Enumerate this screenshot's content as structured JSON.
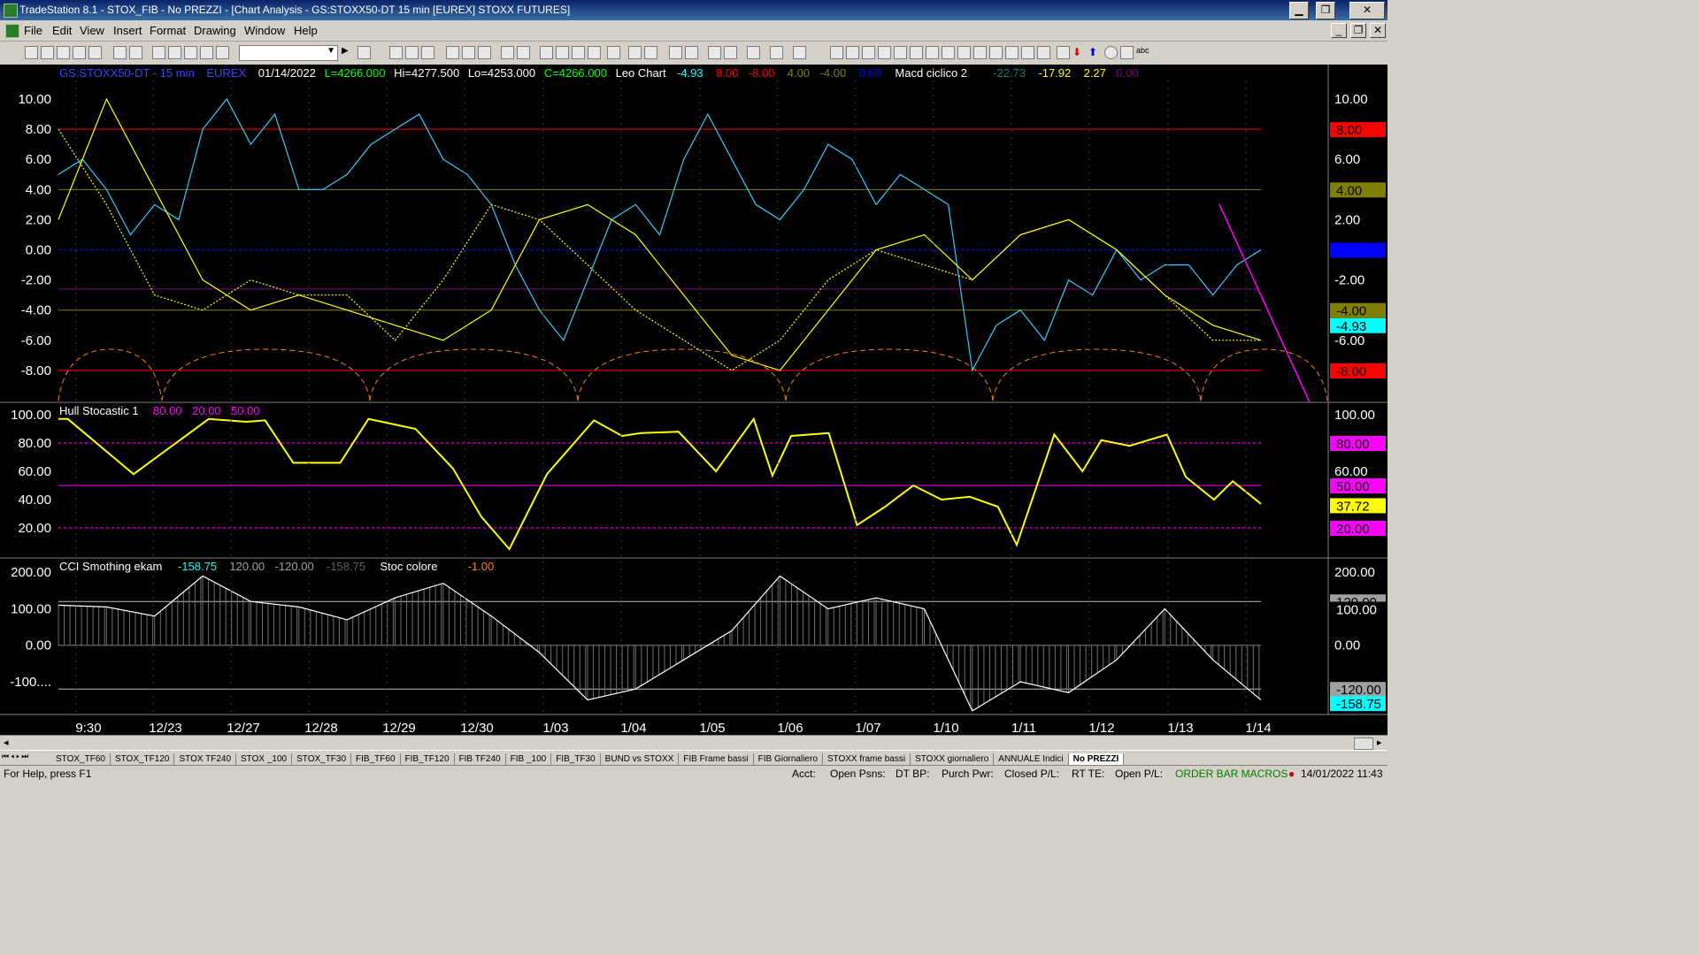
{
  "window": {
    "title": "TradeStation 8.1 - STOX_FIB - No PREZZI - [Chart Analysis - GS:STOXX50-DT  15 min  [EUREX] STOXX FUTURES]",
    "min": "▁",
    "max": "❐",
    "close": "✕",
    "child_min": "_",
    "child_restore": "❐",
    "child_close": "✕"
  },
  "menu": [
    "File",
    "Edit",
    "View",
    "Insert",
    "Format",
    "Drawing",
    "Window",
    "Help"
  ],
  "panel1": {
    "symbol": "GS:STOXX50-DT - 15 min",
    "exchange": "EUREX",
    "date": "01/14/2022",
    "last": "L=4266.000",
    "hi": "Hi=4277.500",
    "lo": "Lo=4253.000",
    "close": "C=4266.000",
    "ind1_name": "Leo Chart",
    "ind1_vals": [
      "-4.93",
      "8.00",
      "-8.00",
      "4.00",
      "-4.00",
      "0.00"
    ],
    "ind1_colors": [
      "#00ffff",
      "#ff0000",
      "#ff0000",
      "#808000",
      "#808000",
      "#0000ff"
    ],
    "ind2_name": "Macd ciclico 2",
    "ind2_vals": [
      "-22.73",
      "-17.92",
      "2.27",
      "0.00"
    ],
    "ind2_colors": [
      "#008080",
      "#ffff00",
      "#ffff00",
      "#800080"
    ],
    "ticks": [
      "10.00",
      "8.00",
      "6.00",
      "4.00",
      "2.00",
      "0.00",
      "-2.00",
      "-4.00",
      "-6.00",
      "-8.00"
    ],
    "tick_values": [
      10,
      8,
      6,
      4,
      2,
      0,
      -2,
      -4,
      -6,
      -8
    ],
    "right_ticks": [
      "10.00",
      "6.00",
      "2.00",
      "-2.00",
      "-6.00"
    ],
    "right_tick_values": [
      10,
      6,
      2,
      -2,
      -6
    ],
    "badges": [
      {
        "label": "8.00",
        "value": 8,
        "bg": "#ff0000",
        "fg": "#000000"
      },
      {
        "label": "4.00",
        "value": 4,
        "bg": "#808000",
        "fg": "#000000"
      },
      {
        "label": "0.00",
        "value": 0,
        "bg": "#0000ff",
        "fg": "#0000ff"
      },
      {
        "label": "-4.00",
        "value": -4,
        "bg": "#808000",
        "fg": "#000000"
      },
      {
        "label": "-4.93",
        "value": -5,
        "bg": "#00ffff",
        "fg": "#000000"
      },
      {
        "label": "-8.00",
        "value": -8,
        "bg": "#ff0000",
        "fg": "#000000"
      }
    ]
  },
  "panel2": {
    "name": "Hull Stocastic 1",
    "vals": [
      "80.00",
      "20.00",
      "50.00"
    ],
    "val_colors": [
      "#ff00ff",
      "#ff00ff",
      "#ff00ff"
    ],
    "ticks": [
      "100.00",
      "80.00",
      "60.00",
      "40.00",
      "20.00"
    ],
    "tick_values": [
      100,
      80,
      60,
      40,
      20
    ],
    "right_ticks": [
      "100.00",
      "60.00"
    ],
    "right_tick_values": [
      100,
      60
    ],
    "badges": [
      {
        "label": "80.00",
        "value": 80,
        "bg": "#ff00ff",
        "fg": "#000000"
      },
      {
        "label": "50.00",
        "value": 50,
        "bg": "#ff00ff",
        "fg": "#000000"
      },
      {
        "label": "37.72",
        "value": 36,
        "bg": "#ffff00",
        "fg": "#000000"
      },
      {
        "label": "20.00",
        "value": 20,
        "bg": "#ff00ff",
        "fg": "#000000"
      }
    ]
  },
  "panel3": {
    "name": "CCI Smothing ekam",
    "vals": [
      "-158.75",
      "120.00",
      "-120.00",
      "-158.75"
    ],
    "val_colors": [
      "#00ffff",
      "#a0a0a0",
      "#a0a0a0",
      "#606060"
    ],
    "ind2_name": "Stoc colore",
    "ind2_vals": [
      "-1.00"
    ],
    "ind2_colors": [
      "#ff8000"
    ],
    "ticks": [
      "200.00",
      "100.00",
      "0.00",
      "-100...."
    ],
    "tick_values": [
      200,
      100,
      0,
      -100
    ],
    "right_ticks": [
      "200.00",
      "0.00"
    ],
    "right_tick_values": [
      200,
      0
    ],
    "badges": [
      {
        "label": "120.00",
        "value": 120,
        "bg": "#a0a0a0",
        "fg": "#000000"
      },
      {
        "label": "100.00",
        "value": 100,
        "bg": "#000000",
        "fg": "#ffffff"
      },
      {
        "label": "-120.00",
        "value": -120,
        "bg": "#a0a0a0",
        "fg": "#000000"
      },
      {
        "label": "-158.75",
        "value": -158.75,
        "bg": "#00ffff",
        "fg": "#000000"
      }
    ]
  },
  "xaxis": [
    "9:30",
    "12/23",
    "12/27",
    "12/28",
    "12/29",
    "12/30",
    "1/03",
    "1/04",
    "1/05",
    "1/06",
    "1/07",
    "1/10",
    "1/11",
    "1/12",
    "1/13",
    "1/14"
  ],
  "tabs": [
    "STOX_TF60",
    "STOX_TF120",
    "STOX TF240",
    "STOX _100",
    "STOX_TF30",
    "FIB_TF60",
    "FIB_TF120",
    "FIB TF240",
    "FIB _100",
    "FIB_TF30",
    "BUND vs STOXX",
    "FIB Frame bassi",
    "FIB Giornaliero",
    "STOXX frame bassi",
    "STOXX giornaliero",
    "ANNUALE Indici",
    "No PREZZI"
  ],
  "active_tab": "No PREZZI",
  "status": {
    "help": "For Help, press F1",
    "acct": "Acct:",
    "open_psns": "Open Psns:",
    "dt_bp": "DT BP:",
    "purch_pwr": "Purch Pwr:",
    "closed_pl": "Closed P/L:",
    "rt_te": "RT TE:",
    "open_pl": "Open P/L:",
    "macros": "ORDER BAR  MACROS",
    "datetime": "14/01/2022 11:43"
  },
  "chart_data": [
    {
      "type": "line",
      "title": "Leo Chart / Macd ciclico 2",
      "ylim": [
        -10,
        11
      ],
      "hlines": [
        8,
        4,
        0,
        -2.6,
        -4,
        -8
      ],
      "series": [
        {
          "name": "Leo Chart",
          "color": "#33ccff",
          "x": [
            0,
            10,
            20,
            30,
            40,
            50,
            60,
            70,
            80,
            90,
            100,
            110,
            120,
            130,
            140,
            150,
            160,
            170,
            180,
            190,
            200,
            210,
            220,
            230,
            240,
            250,
            260,
            270,
            280,
            290,
            300,
            310,
            320,
            330,
            340,
            350,
            360,
            370,
            380,
            390,
            400,
            410,
            420,
            430,
            440,
            450,
            460,
            470,
            480,
            490,
            500
          ],
          "values": [
            5,
            6,
            4,
            1,
            3,
            2,
            8,
            10,
            7,
            9,
            4,
            4,
            5,
            7,
            8,
            9,
            6,
            5,
            3,
            -1,
            -4,
            -6,
            -2,
            2,
            3,
            1,
            6,
            9,
            6,
            3,
            2,
            4,
            7,
            6,
            3,
            5,
            4,
            3,
            -8,
            -5,
            -4,
            -6,
            -2,
            -3,
            0,
            -2,
            -1,
            -1,
            -3,
            -1,
            0
          ]
        },
        {
          "name": "Leo Chart 2",
          "color": "#ffff00",
          "x": [
            0,
            20,
            40,
            60,
            80,
            100,
            120,
            140,
            160,
            180,
            200,
            220,
            240,
            260,
            280,
            300,
            320,
            340,
            360,
            380,
            400,
            420,
            440,
            460,
            480,
            500
          ],
          "values": [
            2,
            10,
            4,
            -2,
            -4,
            -3,
            -4,
            -5,
            -6,
            -4,
            2,
            3,
            1,
            -3,
            -7,
            -8,
            -4,
            0,
            1,
            -2,
            1,
            2,
            0,
            -3,
            -5,
            -6
          ]
        },
        {
          "name": "Macd ciclico 2",
          "color": "#ffff00",
          "x": [
            0,
            20,
            40,
            60,
            80,
            100,
            120,
            140,
            160,
            180,
            200,
            220,
            240,
            260,
            280,
            300,
            320,
            340,
            360,
            380,
            400,
            420,
            440,
            460,
            480,
            500
          ],
          "values": [
            8,
            3,
            -3,
            -4,
            -2,
            -3,
            -3,
            -6,
            -2,
            3,
            2,
            -1,
            -4,
            -6,
            -8,
            -6,
            -2,
            0,
            -1,
            -2,
            1,
            2,
            0,
            -3,
            -6,
            -6
          ]
        }
      ]
    },
    {
      "type": "line",
      "title": "Hull Stocastic 1",
      "ylim": [
        0,
        105
      ],
      "hlines": [
        80,
        50,
        20
      ],
      "series": [
        {
          "name": "Hull Stocastic 1",
          "color": "#ffff00",
          "x": [
            0,
            5,
            40,
            80,
            100,
            110,
            125,
            150,
            165,
            190,
            210,
            225,
            240,
            260,
            285,
            300,
            310,
            330,
            350,
            370,
            380,
            390,
            410,
            425,
            440,
            455,
            470,
            485,
            500,
            510,
            530,
            545,
            555,
            570,
            590,
            600,
            615,
            625,
            640
          ],
          "values": [
            97,
            97,
            58,
            97,
            95,
            96,
            66,
            66,
            97,
            90,
            62,
            28,
            5,
            58,
            96,
            85,
            87,
            88,
            60,
            97,
            57,
            85,
            87,
            22,
            35,
            50,
            40,
            42,
            35,
            8,
            86,
            60,
            82,
            78,
            86,
            56,
            40,
            53,
            37
          ]
        }
      ]
    },
    {
      "type": "line",
      "title": "CCI Smothing ekam / Stoc colore",
      "ylim": [
        -185,
        220
      ],
      "hlines": [
        120,
        0,
        -120
      ],
      "series": [
        {
          "name": "CCI Smothing ekam",
          "color": "#ffffff",
          "x": [
            0,
            20,
            40,
            60,
            80,
            100,
            120,
            140,
            160,
            180,
            200,
            220,
            240,
            260,
            280,
            300,
            320,
            340,
            360,
            380,
            400,
            420,
            440,
            460,
            480,
            500
          ],
          "values": [
            110,
            105,
            80,
            190,
            120,
            105,
            70,
            130,
            170,
            80,
            -20,
            -150,
            -120,
            -40,
            40,
            190,
            100,
            130,
            100,
            -180,
            -100,
            -130,
            -40,
            100,
            -40,
            -150
          ]
        }
      ]
    }
  ]
}
